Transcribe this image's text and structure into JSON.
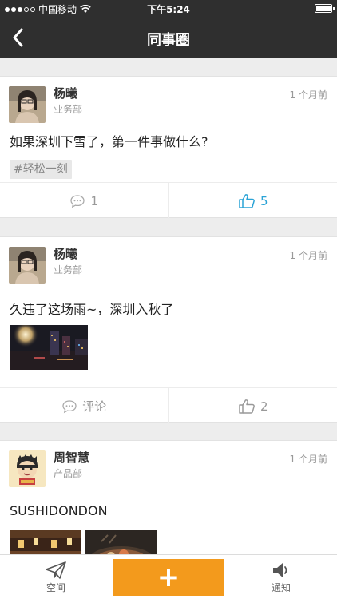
{
  "status_bar": {
    "carrier": "中国移动",
    "time": "下午5:24"
  },
  "nav": {
    "title": "同事圈"
  },
  "posts": [
    {
      "name": "杨曦",
      "dept": "业务部",
      "time": "1 个月前",
      "content": "如果深圳下雪了，第一件事做什么?",
      "tag": "#轻松一刻",
      "comment_label": "1",
      "like_label": "5",
      "liked": true
    },
    {
      "name": "杨曦",
      "dept": "业务部",
      "time": "1 个月前",
      "content": "久违了这场雨~，深圳入秋了",
      "comment_label": "评论",
      "like_label": "2",
      "liked": false
    },
    {
      "name": "周智慧",
      "dept": "产品部",
      "time": "1 个月前",
      "content": "SUSHIDONDON"
    }
  ],
  "tabbar": {
    "space_label": "空间",
    "plus_label": "+",
    "notify_label": "通知"
  },
  "colors": {
    "nav_bg": "#2f2f2f",
    "accent_orange": "#f39a1c",
    "like_blue": "#2aa3d6"
  }
}
